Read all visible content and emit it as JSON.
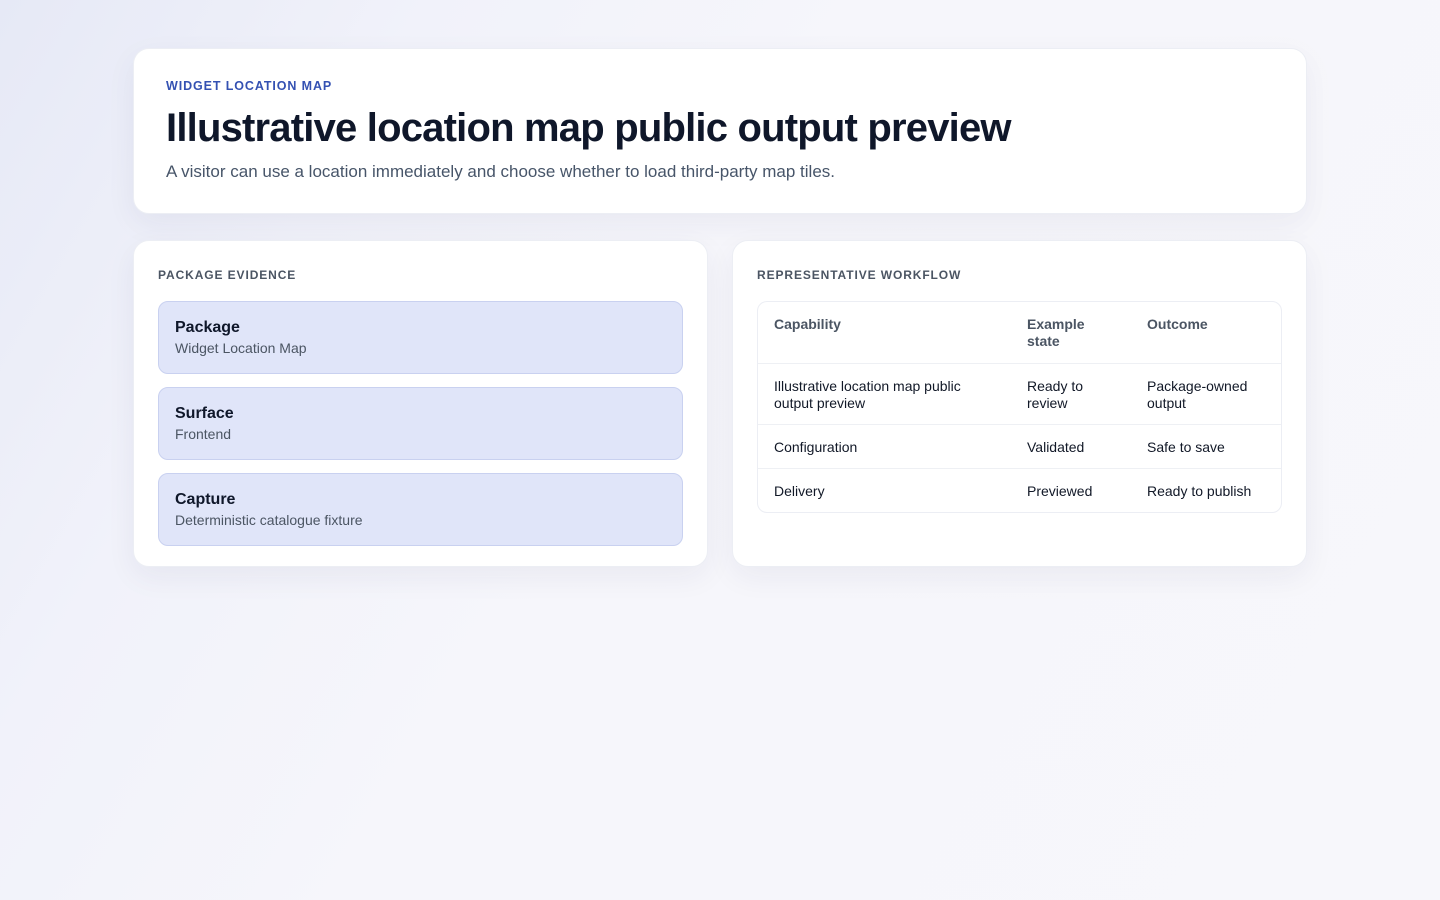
{
  "header": {
    "eyebrow": "WIDGET LOCATION MAP",
    "title": "Illustrative location map public output preview",
    "subtitle": "A visitor can use a location immediately and choose whether to load third-party map tiles."
  },
  "evidence": {
    "heading": "PACKAGE EVIDENCE",
    "items": [
      {
        "label": "Package",
        "value": "Widget Location Map"
      },
      {
        "label": "Surface",
        "value": "Frontend"
      },
      {
        "label": "Capture",
        "value": "Deterministic catalogue fixture"
      }
    ]
  },
  "workflow": {
    "heading": "REPRESENTATIVE WORKFLOW",
    "columns": [
      "Capability",
      "Example state",
      "Outcome"
    ],
    "rows": [
      [
        "Illustrative location map public output preview",
        "Ready to review",
        "Package-owned output"
      ],
      [
        "Configuration",
        "Validated",
        "Safe to save"
      ],
      [
        "Delivery",
        "Previewed",
        "Ready to publish"
      ]
    ]
  },
  "colors": {
    "accent": "#3451b2",
    "evidence_bg": "#e0e5f9",
    "evidence_border": "#c9d1f0"
  }
}
